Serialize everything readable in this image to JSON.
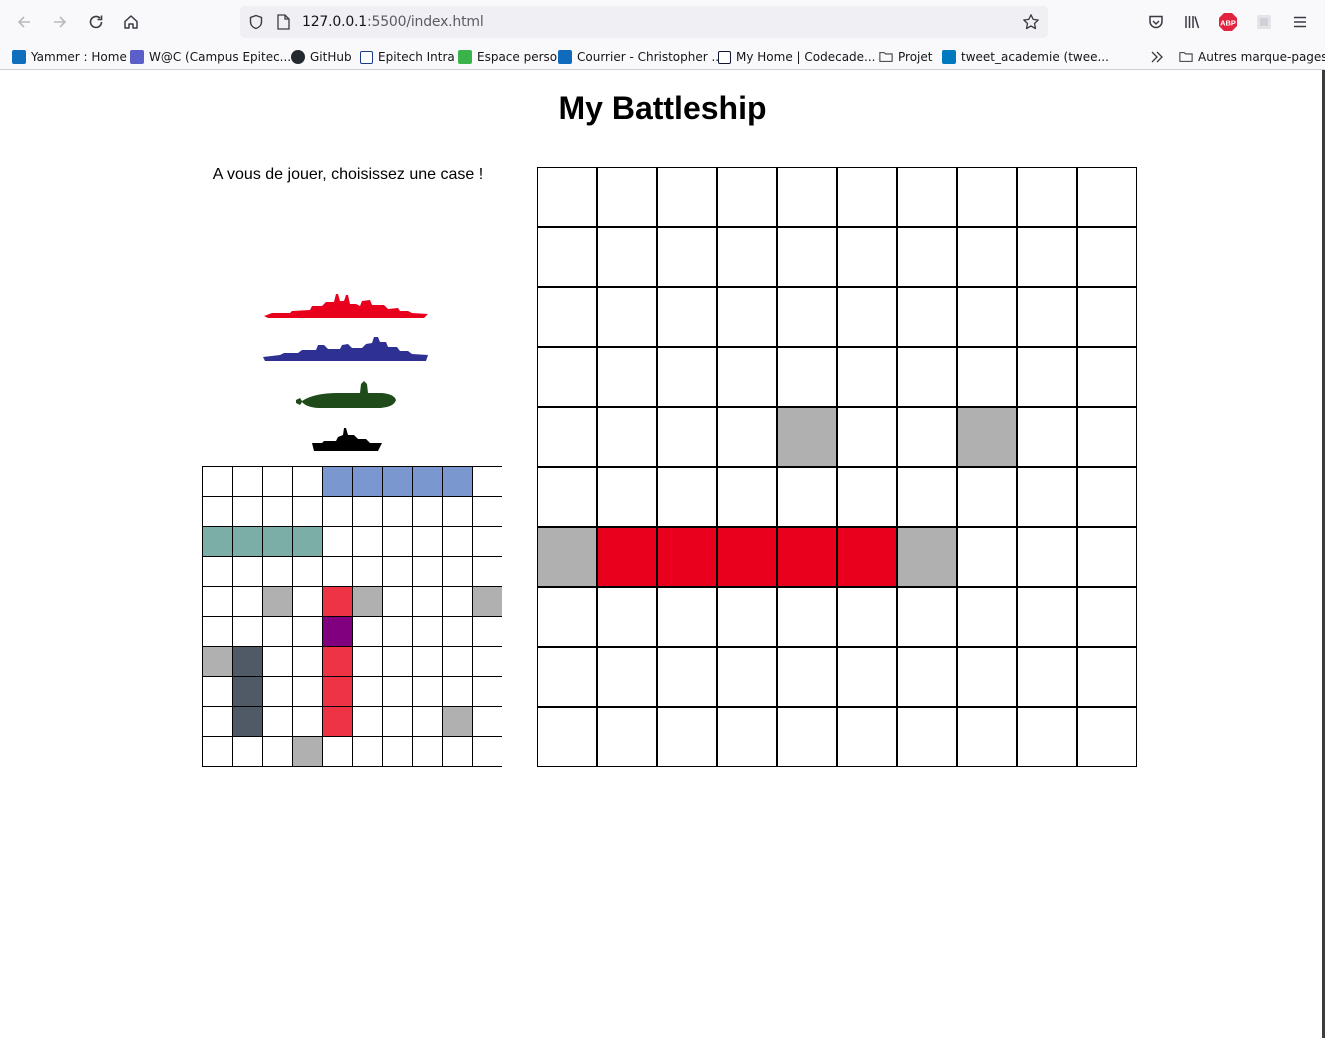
{
  "browser": {
    "url_host": "127.0.0.1",
    "url_path": ":5500/index.html",
    "bookmarks": [
      {
        "label": "Yammer : Home",
        "icon": "yammer-icon",
        "color": "#106ebe"
      },
      {
        "label": "W@C (Campus Epitec...",
        "icon": "teams-icon",
        "color": "#5b5fc7"
      },
      {
        "label": "GitHub",
        "icon": "github-icon",
        "color": "#24292f"
      },
      {
        "label": "Epitech Intra",
        "icon": "epitech-icon",
        "color": "#1b3a8c"
      },
      {
        "label": "Espace perso",
        "icon": "espace-perso-icon",
        "color": "#3ab44a"
      },
      {
        "label": "Courrier - Christopher ...",
        "icon": "outlook-icon",
        "color": "#0f6cbd"
      },
      {
        "label": "My Home | Codecade...",
        "icon": "codecademy-icon",
        "color": "#10162f"
      },
      {
        "label": "Projet",
        "icon": "folder-icon",
        "color": "#5b5b66"
      },
      {
        "label": "tweet_academie (twee...",
        "icon": "trello-icon",
        "color": "#0079bf"
      }
    ],
    "other_bookmarks": "Autres marque-pages",
    "abp_label": "ABP"
  },
  "page": {
    "title": "My Battleship",
    "status": "A vous de jouer, choisissez une case !"
  },
  "colors": {
    "hit": "#e8001d",
    "miss": "#b0b0b0",
    "battleship": "#e8001d",
    "destroyer": "#2e3192",
    "submarine": "#1f4a1a",
    "patrol": "#000000",
    "fleet_blue": "#7b97d0",
    "fleet_teal": "#7aaea6",
    "fleet_red": "#ee3344",
    "fleet_purple": "#800080",
    "fleet_slate": "#4f5a66"
  },
  "ships": [
    {
      "name": "battleship",
      "icon": "battleship-icon",
      "color": "#e8001d"
    },
    {
      "name": "destroyer",
      "icon": "destroyer-icon",
      "color": "#2e3192"
    },
    {
      "name": "submarine",
      "icon": "submarine-icon",
      "color": "#1f4a1a"
    },
    {
      "name": "patrol-boat",
      "icon": "patrol-boat-icon",
      "color": "#000000"
    }
  ],
  "player_grid": {
    "rows": 10,
    "cols": 10,
    "cells": [
      {
        "r": 0,
        "c": 4,
        "state": "ship",
        "color": "#7b97d0"
      },
      {
        "r": 0,
        "c": 5,
        "state": "ship",
        "color": "#7b97d0"
      },
      {
        "r": 0,
        "c": 6,
        "state": "ship",
        "color": "#7b97d0"
      },
      {
        "r": 0,
        "c": 7,
        "state": "ship",
        "color": "#7b97d0"
      },
      {
        "r": 0,
        "c": 8,
        "state": "ship",
        "color": "#7b97d0"
      },
      {
        "r": 2,
        "c": 0,
        "state": "ship",
        "color": "#7aaea6"
      },
      {
        "r": 2,
        "c": 1,
        "state": "ship",
        "color": "#7aaea6"
      },
      {
        "r": 2,
        "c": 2,
        "state": "ship",
        "color": "#7aaea6"
      },
      {
        "r": 2,
        "c": 3,
        "state": "ship",
        "color": "#7aaea6"
      },
      {
        "r": 4,
        "c": 2,
        "state": "miss",
        "color": "#b0b0b0"
      },
      {
        "r": 4,
        "c": 4,
        "state": "ship",
        "color": "#ee3344"
      },
      {
        "r": 4,
        "c": 5,
        "state": "miss",
        "color": "#b0b0b0"
      },
      {
        "r": 4,
        "c": 9,
        "state": "miss",
        "color": "#b0b0b0"
      },
      {
        "r": 5,
        "c": 4,
        "state": "hit",
        "color": "#800080"
      },
      {
        "r": 6,
        "c": 0,
        "state": "miss",
        "color": "#b0b0b0"
      },
      {
        "r": 6,
        "c": 1,
        "state": "ship",
        "color": "#4f5a66"
      },
      {
        "r": 6,
        "c": 4,
        "state": "ship",
        "color": "#ee3344"
      },
      {
        "r": 7,
        "c": 1,
        "state": "ship",
        "color": "#4f5a66"
      },
      {
        "r": 7,
        "c": 4,
        "state": "ship",
        "color": "#ee3344"
      },
      {
        "r": 8,
        "c": 1,
        "state": "ship",
        "color": "#4f5a66"
      },
      {
        "r": 8,
        "c": 4,
        "state": "ship",
        "color": "#ee3344"
      },
      {
        "r": 8,
        "c": 8,
        "state": "miss",
        "color": "#b0b0b0"
      },
      {
        "r": 9,
        "c": 3,
        "state": "miss",
        "color": "#b0b0b0"
      }
    ]
  },
  "opponent_grid": {
    "rows": 10,
    "cols": 10,
    "cells": [
      {
        "r": 4,
        "c": 4,
        "state": "miss",
        "color": "#b0b0b0"
      },
      {
        "r": 4,
        "c": 7,
        "state": "miss",
        "color": "#b0b0b0"
      },
      {
        "r": 6,
        "c": 0,
        "state": "miss",
        "color": "#b0b0b0"
      },
      {
        "r": 6,
        "c": 1,
        "state": "hit",
        "color": "#e8001d"
      },
      {
        "r": 6,
        "c": 2,
        "state": "hit",
        "color": "#e8001d"
      },
      {
        "r": 6,
        "c": 3,
        "state": "hit",
        "color": "#e8001d"
      },
      {
        "r": 6,
        "c": 4,
        "state": "hit",
        "color": "#e8001d"
      },
      {
        "r": 6,
        "c": 5,
        "state": "hit",
        "color": "#e8001d"
      },
      {
        "r": 6,
        "c": 6,
        "state": "miss",
        "color": "#b0b0b0"
      }
    ]
  }
}
